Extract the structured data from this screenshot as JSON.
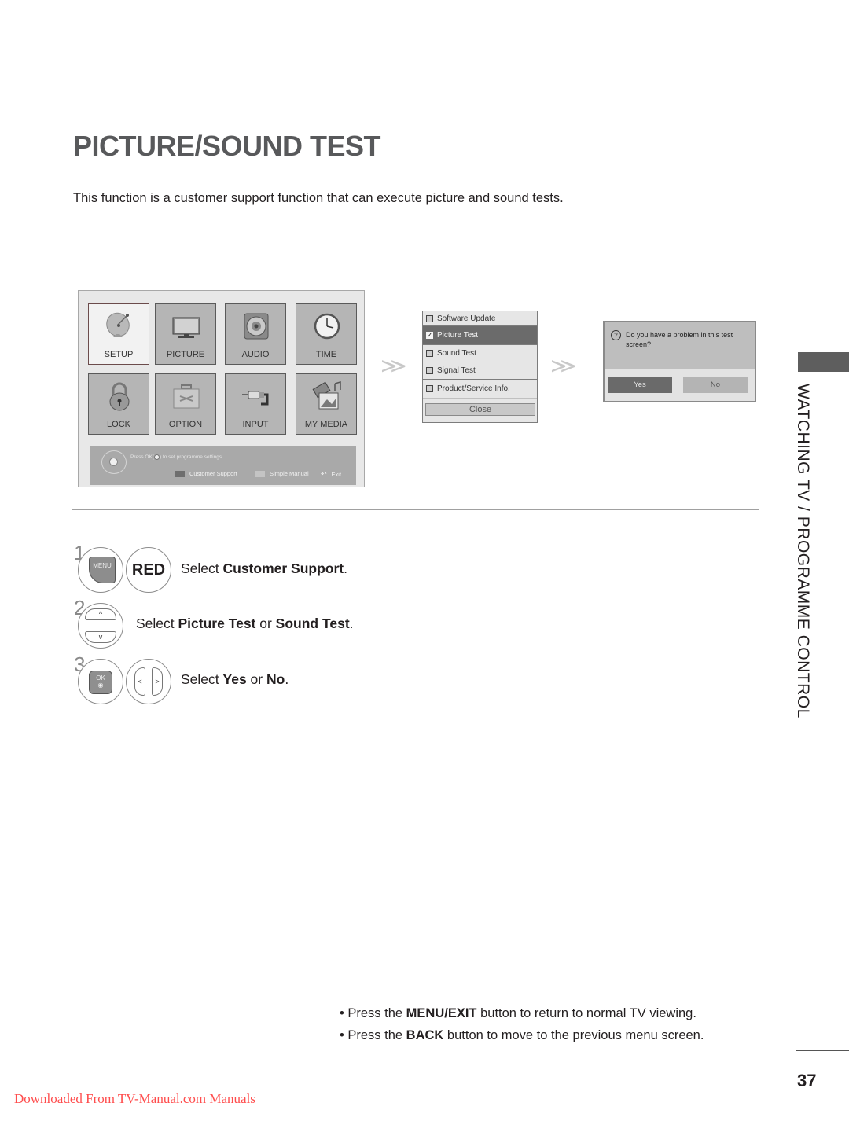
{
  "page": {
    "title": "PICTURE/SOUND TEST",
    "intro": "This function is a customer support function that can execute picture and sound tests.",
    "section_tab": "WATCHING TV / PROGRAMME CONTROL",
    "page_number": "37",
    "footer_link": "Downloaded From TV-Manual.com Manuals"
  },
  "main_menu": {
    "tiles": [
      {
        "label": "SETUP",
        "icon": "satellite-dish-icon",
        "active": true
      },
      {
        "label": "PICTURE",
        "icon": "tv-monitor-icon",
        "active": false
      },
      {
        "label": "AUDIO",
        "icon": "speaker-icon",
        "active": false
      },
      {
        "label": "TIME",
        "icon": "clock-icon",
        "active": false
      },
      {
        "label": "LOCK",
        "icon": "padlock-icon",
        "active": false
      },
      {
        "label": "OPTION",
        "icon": "toolbox-icon",
        "active": false
      },
      {
        "label": "INPUT",
        "icon": "cable-plug-icon",
        "active": false
      },
      {
        "label": "MY MEDIA",
        "icon": "media-icon",
        "active": false
      }
    ],
    "hint_prefix": "Press OK(",
    "hint_suffix": ") to set programme settings.",
    "legend": [
      {
        "label": "Customer Support",
        "color": "#6e6e6e"
      },
      {
        "label": "Simple Manual",
        "color": "#c4c4c4"
      },
      {
        "label": "Exit",
        "icon": "back-arrow-icon"
      }
    ]
  },
  "customer_support": {
    "items": [
      {
        "label": "Software Update",
        "checked": false
      },
      {
        "label": "Picture Test",
        "checked": true
      },
      {
        "label": "Sound Test",
        "checked": false
      },
      {
        "label": "Signal Test",
        "checked": false
      },
      {
        "label": "Product/Service Info.",
        "checked": false
      }
    ],
    "close_label": "Close"
  },
  "confirm_dialog": {
    "question_icon": "?",
    "message": "Do you have a problem in this test screen?",
    "yes_label": "Yes",
    "no_label": "No"
  },
  "steps": [
    {
      "number": "1",
      "keys": [
        "MENU",
        "RED"
      ],
      "pre": "Select ",
      "bold1": "Customer Support",
      "post": "."
    },
    {
      "number": "2",
      "keys": [
        "^",
        "v"
      ],
      "pre": "Select ",
      "bold1": "Picture Test",
      "mid": " or ",
      "bold2": "Sound Test",
      "post": "."
    },
    {
      "number": "3",
      "keys": [
        "OK",
        "<",
        ">"
      ],
      "pre": "Select ",
      "bold1": "Yes",
      "mid": " or ",
      "bold2": "No",
      "post": "."
    }
  ],
  "notes": [
    {
      "pre": "Press the ",
      "bold": "MENU/EXIT",
      "post": " button to return to normal TV viewing."
    },
    {
      "pre": "Press the ",
      "bold": "BACK",
      "post": " button to move to the previous menu screen."
    }
  ],
  "bullet": "•",
  "arrow_glyph": "≫"
}
